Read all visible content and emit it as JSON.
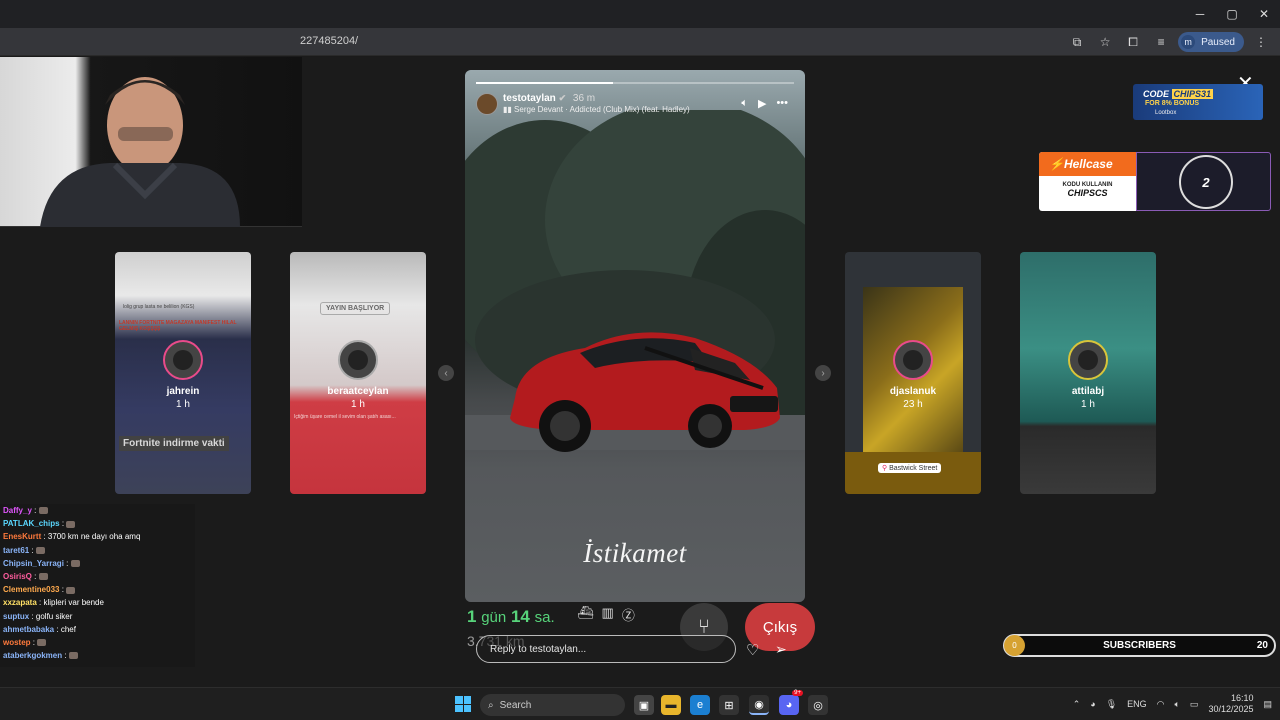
{
  "browser": {
    "url_fragment": "227485204/",
    "profile_initial": "m",
    "profile_status": "Paused",
    "window_controls": {
      "minimize": "─",
      "maximize": "▢",
      "close": "✕"
    }
  },
  "stories_left": [
    {
      "username": "jahrein",
      "time": "1 h",
      "text": "Fortnite indirme vakti",
      "header": "lolig grup lasta ne belilion (KGS)",
      "headline": "LANNIN FORTNITE MAGAZAYA MANIFEST HILAL GELMIŞ KOŞŞŞŞ"
    },
    {
      "username": "beraatceylan",
      "time": "1 h",
      "badge": "YAYIN BAŞLIYOR",
      "subtext": "Içtiğim üşare cemel il sevim olan şatıh asası..."
    }
  ],
  "stories_right": [
    {
      "username": "djaslanuk",
      "time": "23 h",
      "location": "Bastwick Street"
    },
    {
      "username": "attilabj",
      "time": "1 h"
    }
  ],
  "main_story": {
    "username": "testotaylan",
    "verified": true,
    "ago": "36 m",
    "music": "Serge Devant · Addicted (Club Mix) (feat. Hadley)",
    "progress": 0.43,
    "caption": "İstikamet",
    "reply_placeholder": "Reply to testotaylan..."
  },
  "navigation_overlay": {
    "eta_days": "1",
    "eta_days_unit": "gün",
    "eta_hours": "14",
    "eta_hours_unit": "sa.",
    "distance": "3.731 km",
    "exit_label": "Çıkış"
  },
  "ads": {
    "lootbox": {
      "code_prefix": "CODE",
      "code": "CHIPS31",
      "bonus": "FOR 8% BONUS",
      "brand": "Lootbox"
    },
    "hellcase": {
      "brand": "Hellcase",
      "subtitle": "KODU KULLANIN",
      "code": "CHIPSCS",
      "counter": "2"
    }
  },
  "chat": [
    {
      "user": "Daffy_y",
      "color": "#e056fd",
      "msg": ""
    },
    {
      "user": "PATLAK_chips",
      "color": "#5bd8ff",
      "msg": ""
    },
    {
      "user": "EnesKurtt",
      "color": "#ff7a3c",
      "msg": "3700 km ne dayı oha amq"
    },
    {
      "user": "taret61",
      "color": "#8ab4f8",
      "msg": ""
    },
    {
      "user": "Chipsin_Yarragi",
      "color": "#8ab4f8",
      "msg": ""
    },
    {
      "user": "OsirisQ",
      "color": "#ff5d9e",
      "msg": ""
    },
    {
      "user": "Clementine033",
      "color": "#ffa94d",
      "msg": ""
    },
    {
      "user": "xxzapata",
      "color": "#ffe066",
      "msg": "klipleri var bende"
    },
    {
      "user": "suptux",
      "color": "#8ab4f8",
      "msg": "golfu siker"
    },
    {
      "user": "ahmetbabaka",
      "color": "#8ab4f8",
      "msg": "chef"
    },
    {
      "user": "wostep",
      "color": "#ff7a3c",
      "msg": ""
    },
    {
      "user": "ataberkgokmen",
      "color": "#8ab4f8",
      "msg": ""
    }
  ],
  "subscribers": {
    "current": "0",
    "label": "SUBSCRIBERS",
    "target": "20"
  },
  "taskbar": {
    "search_placeholder": "Search",
    "language": "ENG",
    "time": "16:10",
    "date": "30/12/2025",
    "notification_badge": "9+"
  }
}
